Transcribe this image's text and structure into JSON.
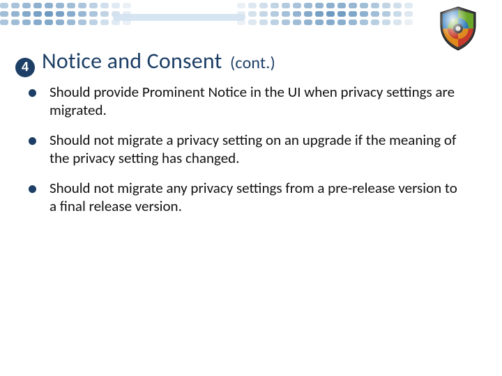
{
  "header": {
    "number": "4",
    "title_main": "Notice and Consent",
    "title_cont": "(cont.)"
  },
  "bullets": [
    "Should provide Prominent Notice in the UI when privacy settings are migrated.",
    "Should not migrate a privacy setting on an upgrade if the meaning of the privacy setting has changed.",
    "Should not migrate any privacy settings from a pre-release version to a final release version."
  ]
}
